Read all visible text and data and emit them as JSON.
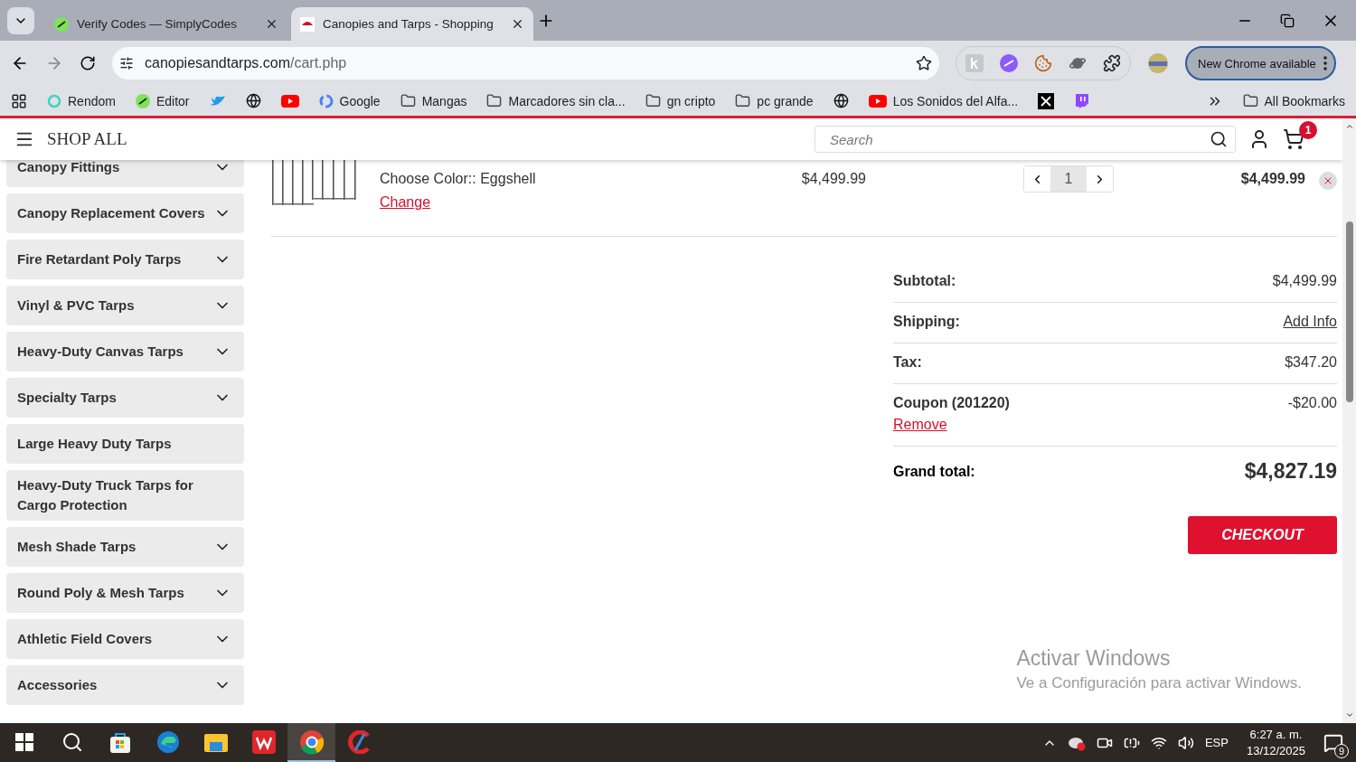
{
  "browser": {
    "tabs": [
      {
        "title": "Verify Codes — SimplyCodes",
        "selected": false
      },
      {
        "title": "Canopies and Tarps - Shopping",
        "selected": true
      }
    ],
    "address": {
      "host": "canopiesandtarps.com",
      "path": "/cart.php"
    },
    "update_button": "New Chrome available",
    "bookmarks": [
      "Rendom",
      "Editor",
      "Google",
      "Mangas",
      "Marcadores sin cla...",
      "gn cripto",
      "pc grande",
      "Los Sonidos del Alfa..."
    ],
    "all_bookmarks": "All Bookmarks"
  },
  "header": {
    "menu_label": "SHOP ALL",
    "search_placeholder": "Search",
    "cart_count": "1"
  },
  "sidebar": {
    "items": [
      {
        "label": "Canopy Fittings",
        "expandable": true
      },
      {
        "label": "Canopy Replacement Covers",
        "expandable": true
      },
      {
        "label": "Fire Retardant Poly Tarps",
        "expandable": true
      },
      {
        "label": "Vinyl & PVC Tarps",
        "expandable": true
      },
      {
        "label": "Heavy-Duty Canvas Tarps",
        "expandable": true
      },
      {
        "label": "Specialty Tarps",
        "expandable": true
      },
      {
        "label": "Large Heavy Duty Tarps",
        "expandable": false
      },
      {
        "label": "Heavy-Duty Truck Tarps for Cargo Protection",
        "expandable": false
      },
      {
        "label": "Mesh Shade Tarps",
        "expandable": true
      },
      {
        "label": "Round Poly & Mesh Tarps",
        "expandable": true
      },
      {
        "label": "Athletic Field Covers",
        "expandable": true
      },
      {
        "label": "Accessories",
        "expandable": true
      }
    ]
  },
  "cart_item": {
    "option_label": "Choose Color::",
    "option_value": "Eggshell",
    "change_link": "Change",
    "price": "$4,499.99",
    "quantity": "1",
    "total": "$4,499.99"
  },
  "summary": {
    "rows": [
      {
        "label": "Subtotal:",
        "value": "$4,499.99",
        "kind": "text"
      },
      {
        "label": "Shipping:",
        "value": "Add Info",
        "kind": "link"
      },
      {
        "label": "Tax:",
        "value": "$347.20",
        "kind": "text"
      },
      {
        "label": "Coupon (201220)",
        "value": "-$20.00",
        "kind": "coupon",
        "action": "Remove"
      }
    ],
    "grand_total_label": "Grand total:",
    "grand_total": "$4,827.19",
    "checkout": "CHECKOUT"
  },
  "activation_notice": {
    "title": "Activar Windows",
    "subtitle": "Ve a Configuración para activar Windows."
  },
  "taskbar": {
    "apps": [
      {
        "selected": false
      },
      {
        "selected": false
      },
      {
        "selected": false
      },
      {
        "selected": false
      },
      {
        "selected": false
      },
      {
        "selected": false
      },
      {
        "selected": true
      },
      {
        "selected": false
      }
    ],
    "language": "ESP",
    "time": "6:27 a. m.",
    "date": "13/12/2025",
    "notifications": "9"
  }
}
